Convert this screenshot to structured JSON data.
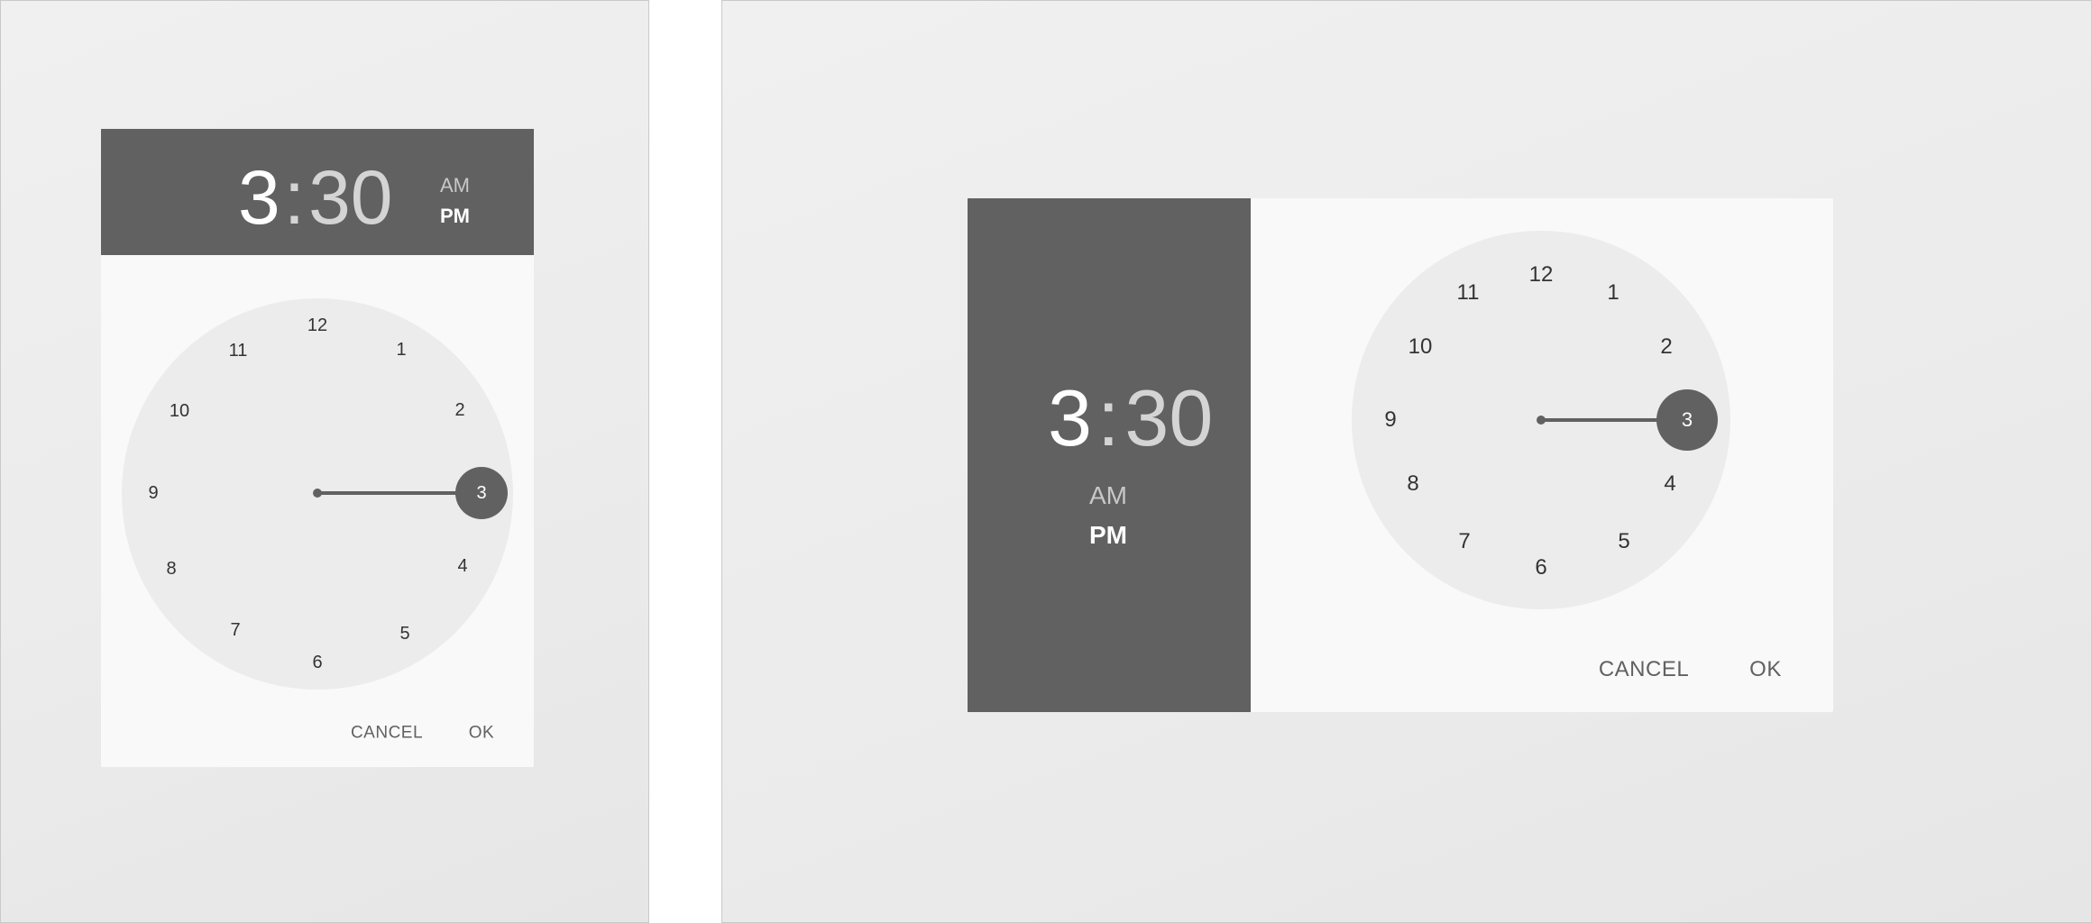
{
  "portrait": {
    "time": {
      "hour": "3",
      "colon": ":",
      "minutes": "30"
    },
    "am_label": "AM",
    "pm_label": "PM",
    "selected_period": "PM",
    "clock_numbers": [
      "12",
      "1",
      "2",
      "3",
      "4",
      "5",
      "6",
      "7",
      "8",
      "9",
      "10",
      "11"
    ],
    "selected_hour": "3",
    "cancel_label": "CANCEL",
    "ok_label": "OK"
  },
  "landscape": {
    "time": {
      "hour": "3",
      "colon": ":",
      "minutes": "30"
    },
    "am_label": "AM",
    "pm_label": "PM",
    "selected_period": "PM",
    "clock_numbers": [
      "12",
      "1",
      "2",
      "3",
      "4",
      "5",
      "6",
      "7",
      "8",
      "9",
      "10",
      "11"
    ],
    "selected_hour": "3",
    "cancel_label": "CANCEL",
    "ok_label": "OK"
  },
  "colors": {
    "header": "#616161",
    "dialog": "#f9f9f9",
    "clock_face": "#ececec",
    "accent": "#616161",
    "text_secondary": "#d4d4d4"
  }
}
